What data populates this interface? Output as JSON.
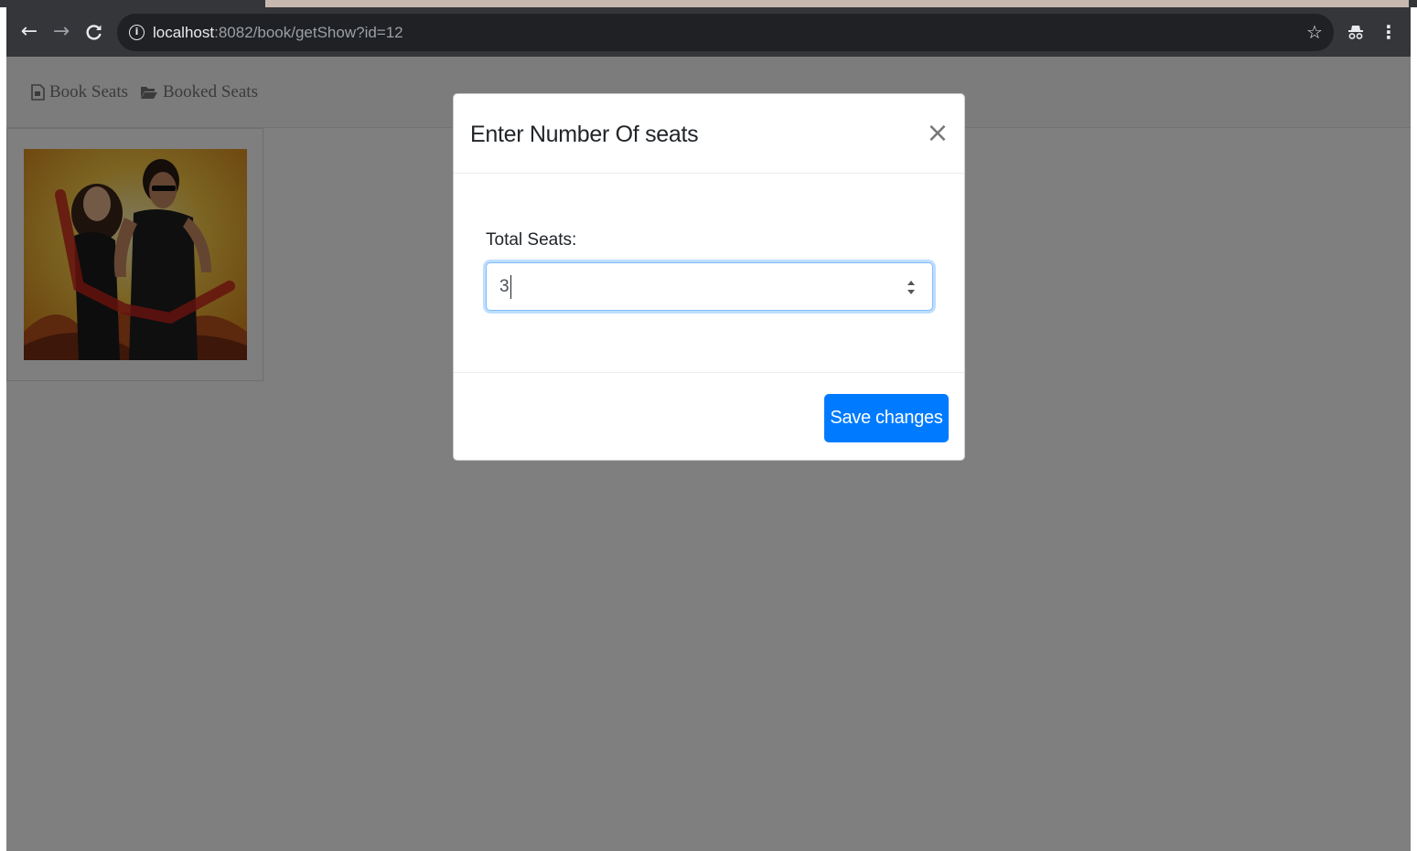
{
  "browser": {
    "url_host": "localhost",
    "url_rest": ":8082/book/getShow?id=12"
  },
  "navbar": {
    "book_seats": "Book Seats",
    "booked_seats": "Booked Seats"
  },
  "modal": {
    "title": "Enter Number Of seats",
    "close_label": "×",
    "field_label": "Total Seats:",
    "field_value": "3",
    "save_label": "Save changes"
  },
  "colors": {
    "primary": "#007bff",
    "backdrop": "rgba(0,0,0,0.5)"
  }
}
